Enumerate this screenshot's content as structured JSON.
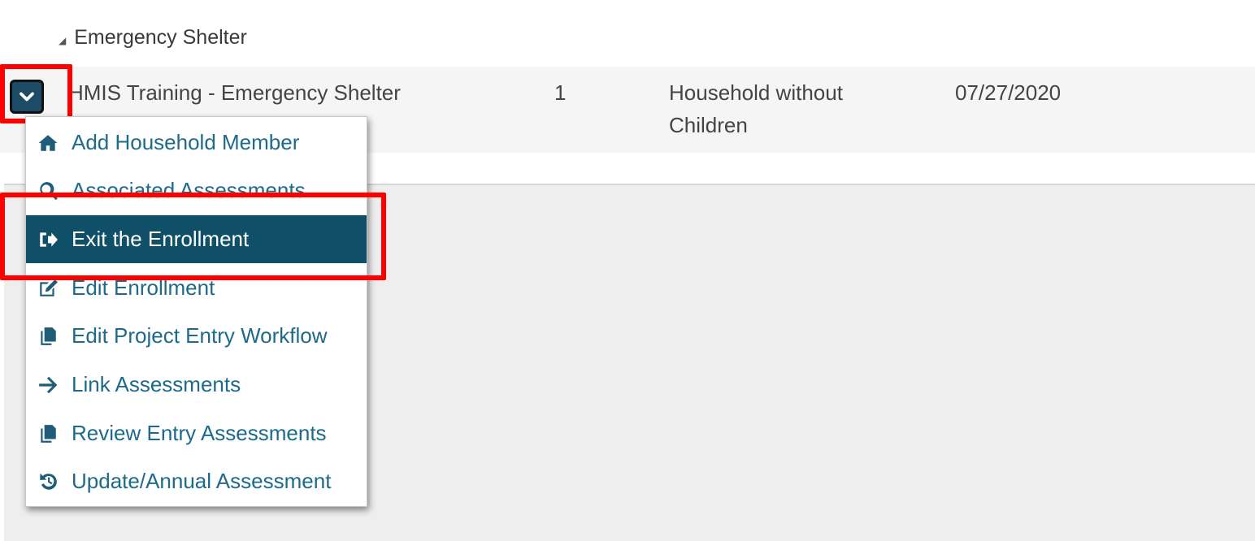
{
  "group": {
    "title": "Emergency Shelter"
  },
  "enrollment_row": {
    "program": "HMIS Training - Emergency Shelter",
    "members": "1",
    "household_type_line1": "Household without",
    "household_type_line2": "Children",
    "date": "07/27/2020"
  },
  "toggle": {
    "icon": "chevron-down-icon"
  },
  "menu": {
    "items": [
      {
        "label": "Add Household Member",
        "icon": "home-icon"
      },
      {
        "label": "Associated Assessments",
        "icon": "search-icon"
      },
      {
        "label": "Exit the Enrollment",
        "icon": "sign-out-icon",
        "active": true
      },
      {
        "label": "Edit Enrollment",
        "icon": "edit-icon"
      },
      {
        "label": "Edit Project Entry Workflow",
        "icon": "copy-icon"
      },
      {
        "label": "Link Assessments",
        "icon": "arrow-right-icon"
      },
      {
        "label": "Review Entry Assessments",
        "icon": "copy-icon"
      },
      {
        "label": "Update/Annual Assessment",
        "icon": "history-icon"
      }
    ]
  },
  "colors": {
    "accent": "#0f5068",
    "link": "#1d6a8a",
    "highlight": "#ff0000",
    "row_bg": "#f5f5f5",
    "panel_bg": "#eeeeee"
  }
}
